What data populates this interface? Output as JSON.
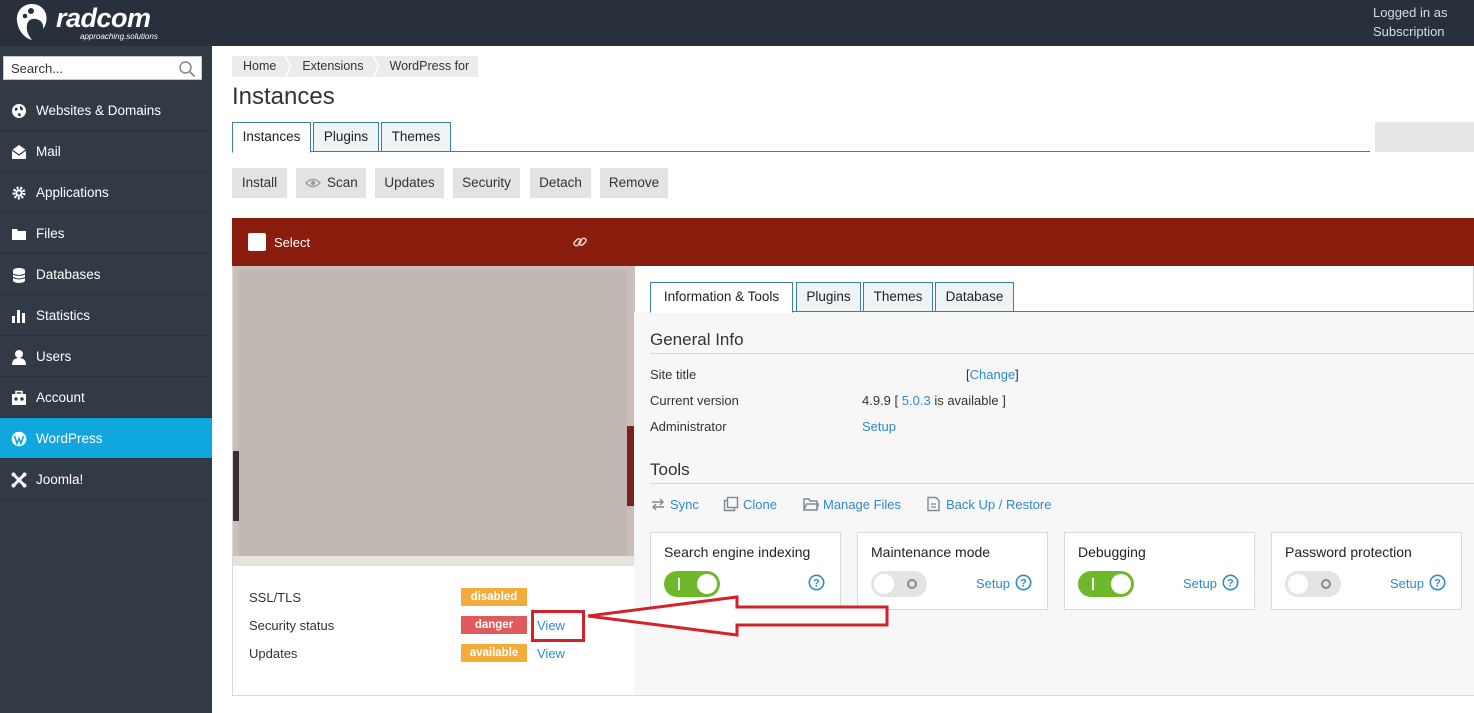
{
  "header": {
    "logo_name": "radcom",
    "logo_tagline": "approaching.solutions",
    "logged_line1": "Logged in as",
    "logged_line2": "Subscription"
  },
  "sidebar": {
    "search_placeholder": "Search...",
    "items": [
      {
        "label": "Websites & Domains",
        "icon": "globe-icon"
      },
      {
        "label": "Mail",
        "icon": "mail-icon"
      },
      {
        "label": "Applications",
        "icon": "gear-icon"
      },
      {
        "label": "Files",
        "icon": "folder-icon"
      },
      {
        "label": "Databases",
        "icon": "database-icon"
      },
      {
        "label": "Statistics",
        "icon": "bar-chart-icon"
      },
      {
        "label": "Users",
        "icon": "user-icon"
      },
      {
        "label": "Account",
        "icon": "briefcase-icon"
      },
      {
        "label": "WordPress",
        "icon": "wordpress-icon"
      },
      {
        "label": "Joomla!",
        "icon": "joomla-icon"
      }
    ],
    "active_item": "WordPress"
  },
  "breadcrumb": [
    "Home",
    "Extensions",
    "WordPress for"
  ],
  "page_title": "Instances",
  "tabs": [
    "Instances",
    "Plugins",
    "Themes"
  ],
  "active_tab": "Instances",
  "toolbar": {
    "install": "Install",
    "scan": "Scan",
    "updates": "Updates",
    "security": "Security",
    "detach": "Detach",
    "remove": "Remove"
  },
  "instance": {
    "select_label": "Select",
    "header_color": "#8a1d0d",
    "status": [
      {
        "label": "SSL/TLS",
        "badge": "disabled",
        "link": ""
      },
      {
        "label": "Security status",
        "badge": "danger",
        "link": "View"
      },
      {
        "label": "Updates",
        "badge": "available",
        "link": "View"
      }
    ],
    "detail_tabs": [
      "Information & Tools",
      "Plugins",
      "Themes",
      "Database"
    ],
    "active_detail_tab": "Information & Tools",
    "general_info": {
      "heading": "General Info",
      "site_title_label": "Site title",
      "site_title_open": "[",
      "site_title_change": "Change",
      "site_title_close": "]",
      "version_label": "Current version",
      "version_current": "4.9.9 [",
      "version_new": "5.0.3",
      "version_suffix": "is available ]",
      "admin_label": "Administrator",
      "admin_value": "Setup"
    },
    "tools": {
      "heading": "Tools",
      "items": [
        "Sync",
        "Clone",
        "Manage Files",
        "Back Up / Restore"
      ]
    },
    "cards": [
      {
        "title": "Search engine indexing",
        "toggle": "on",
        "setup": ""
      },
      {
        "title": "Maintenance mode",
        "toggle": "off",
        "setup": "Setup"
      },
      {
        "title": "Debugging",
        "toggle": "on",
        "setup": "Setup"
      },
      {
        "title": "Password protection",
        "toggle": "off",
        "setup": "Setup"
      }
    ]
  },
  "colors": {
    "sidebar_bg": "#323a45",
    "active_nav": "#10a7df",
    "link": "#2f8ac9",
    "toggle_on": "#6fb82c",
    "badge_warning": "#f3ac3a",
    "badge_danger": "#e05b5b",
    "annotation": "#d2232a"
  }
}
